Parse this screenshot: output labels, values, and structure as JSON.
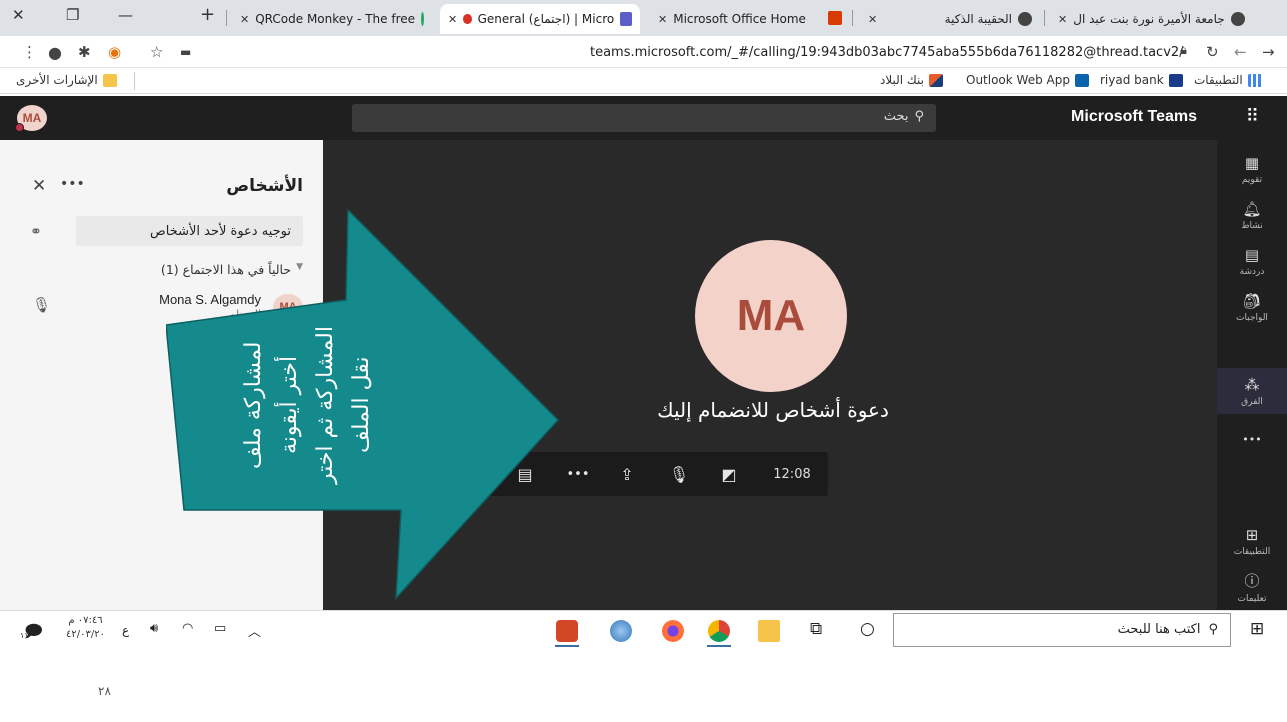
{
  "browser": {
    "tabs": [
      {
        "label": "QRCode Monkey - The free"
      },
      {
        "label": "General (اجتماع) | Micro"
      },
      {
        "label": "Microsoft Office Home"
      },
      {
        "label": "الحقيبة الذكية"
      },
      {
        "label": "جامعة الأميرة نورة بنت عبد ال"
      }
    ],
    "url": "teams.microsoft.com/_#/calling/19:943db03abc7745aba555b6da76118282@thread.tacv2/",
    "bookmarks": {
      "other": "الإشارات الأخرى",
      "items": [
        "بنك البلاد",
        "Outlook Web App",
        "riyad bank",
        "التطبيقات"
      ]
    }
  },
  "teams": {
    "avatar": "MA",
    "search_placeholder": "بحث",
    "app_title": "Microsoft Teams",
    "rail": [
      {
        "label": "تقويم",
        "icon": "calendar-icon"
      },
      {
        "label": "نشاط",
        "icon": "bell-icon"
      },
      {
        "label": "دردشة",
        "icon": "chat-icon"
      },
      {
        "label": "الواجبات",
        "icon": "assignments-icon"
      },
      {
        "label": "الفرق",
        "icon": "teams-icon"
      },
      {
        "label": "التطبيقات",
        "icon": "apps-icon"
      },
      {
        "label": "تعليمات",
        "icon": "help-icon"
      }
    ],
    "more": "•••"
  },
  "people_panel": {
    "title": "الأشخاص",
    "more": "•••",
    "invite_label": "توجيه دعوة لأحد الأشخاص",
    "section_label": "حالياً في هذا الاجتماع (1)",
    "person": {
      "name": "Mona S. Algamdy",
      "role": "المنظم",
      "initials": "MA"
    }
  },
  "stage": {
    "initials": "MA",
    "invite_text": "دعوة أشخاص للانضمام إليك"
  },
  "controls": {
    "timer": "12:08",
    "more": "•••"
  },
  "overlay": {
    "text": "لمشاركة ملف أختر أيقونة المشاركة ثم اختر نقل الملف"
  },
  "taskbar": {
    "search_placeholder": "اكتب هنا للبحث",
    "time": "٠٧:٤٦ م",
    "date": "٤٢/٠٣/٢٠",
    "lang": "ع",
    "notif_count": "١١"
  },
  "page_number": "٢٨",
  "colors": {
    "teal": "#148a8c",
    "teams_dark": "#1f1f1f",
    "stage": "#292929",
    "avatar_bg": "#f3d2c9",
    "avatar_fg": "#a94c3c"
  }
}
